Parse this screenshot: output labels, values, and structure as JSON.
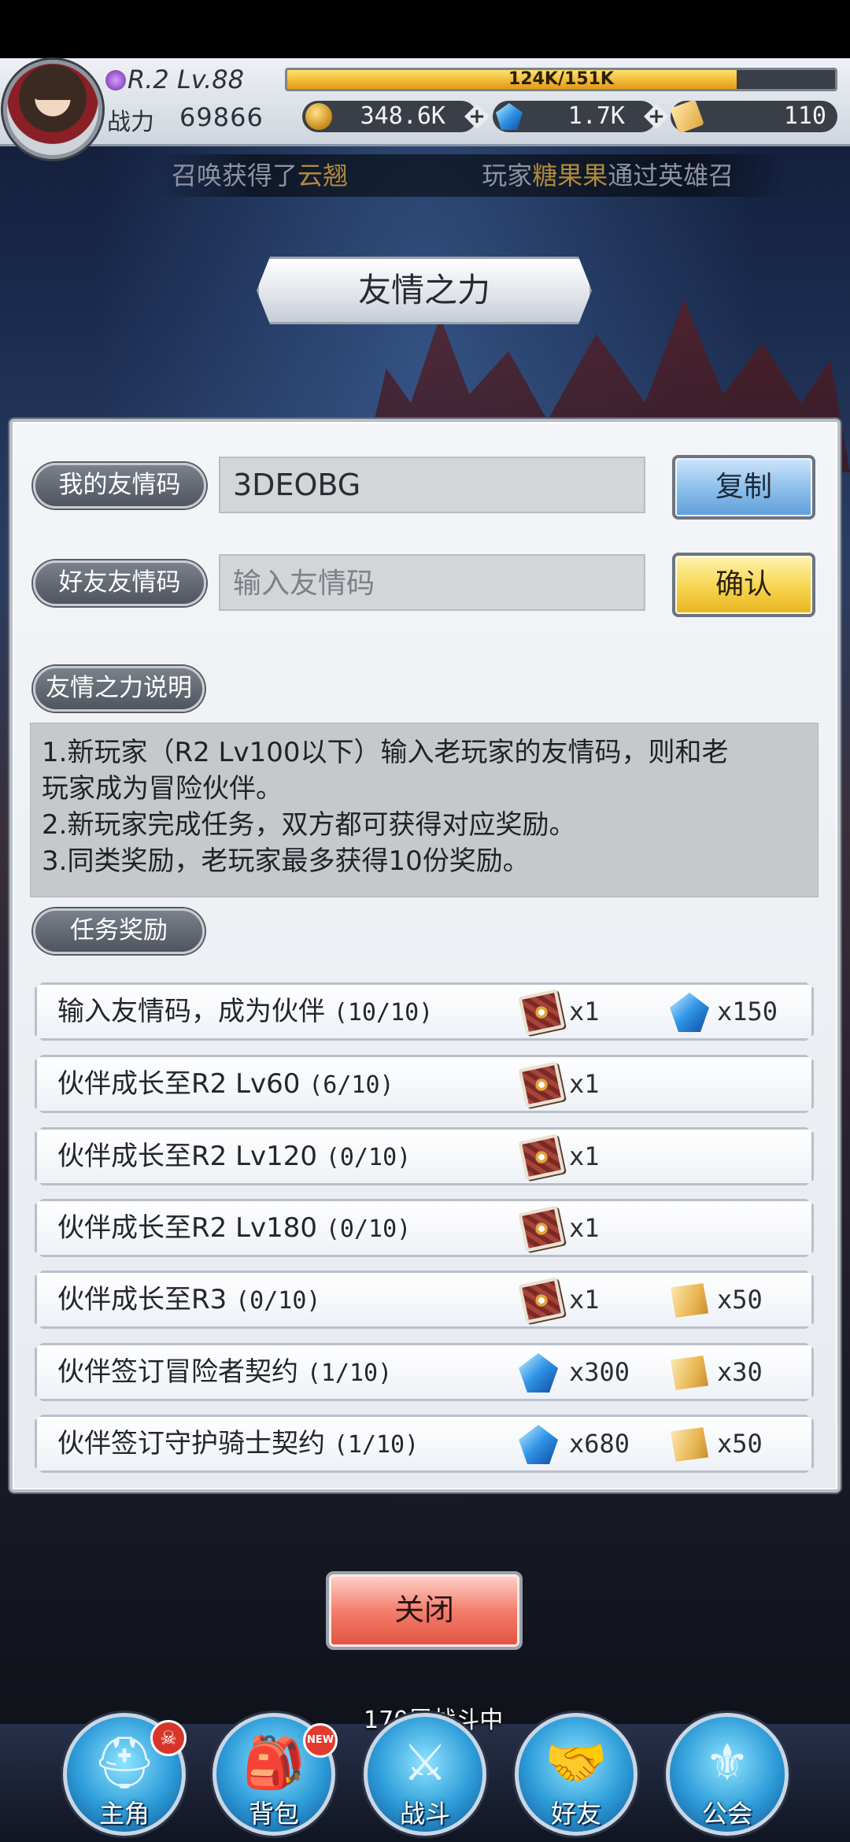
{
  "header": {
    "rank_level": "R.2 Lv.88",
    "xp_text": "124K/151K",
    "xp_fraction": 0.82,
    "power_label": "战力",
    "power_value": "69866",
    "gold": "348.6K",
    "gems": "1.7K",
    "tickets": "110"
  },
  "marquee": {
    "left_part1": "召唤获得了",
    "left_highlight": "云翘",
    "right_part1": "玩家",
    "right_highlight": "糖果果",
    "right_part2": "通过英雄召"
  },
  "title": "友情之力",
  "my_code": {
    "label": "我的友情码",
    "value": "3DEOBG",
    "button": "复制"
  },
  "friend_code": {
    "label": "好友友情码",
    "placeholder": "输入友情码",
    "button": "确认"
  },
  "description": {
    "label": "友情之力说明",
    "lines": [
      "1.新玩家（R2 Lv100以下）输入老玩家的友情码，则和老",
      "玩家成为冒险伙伴。",
      "2.新玩家完成任务，双方都可获得对应奖励。",
      "3.同类奖励，老玩家最多获得10份奖励。"
    ]
  },
  "tasks": {
    "label": "任务奖励",
    "items": [
      {
        "text": "输入友情码，成为伙伴",
        "progress": "(10/10)",
        "r1_icon": "card-icon",
        "r1_qty": "x1",
        "r2_icon": "diamond-icon",
        "r2_qty": "x150"
      },
      {
        "text": "伙伴成长至R2 Lv60",
        "progress": "(6/10)",
        "r1_icon": "card-icon",
        "r1_qty": "x1"
      },
      {
        "text": "伙伴成长至R2 Lv120",
        "progress": "(0/10)",
        "r1_icon": "card-icon",
        "r1_qty": "x1"
      },
      {
        "text": "伙伴成长至R2 Lv180",
        "progress": "(0/10)",
        "r1_icon": "card-icon",
        "r1_qty": "x1"
      },
      {
        "text": "伙伴成长至R3",
        "progress": "(0/10)",
        "r1_icon": "card-icon",
        "r1_qty": "x1",
        "r2_icon": "scroll-icon",
        "r2_qty": "x50"
      },
      {
        "text": "伙伴签订冒险者契约",
        "progress": "(1/10)",
        "r1_icon": "diamond-icon",
        "r1_qty": "x300",
        "r2_icon": "scroll-icon",
        "r2_qty": "x30"
      },
      {
        "text": "伙伴签订守护骑士契约",
        "progress": "(1/10)",
        "r1_icon": "diamond-icon",
        "r1_qty": "x680",
        "r2_icon": "scroll-icon",
        "r2_qty": "x50"
      }
    ]
  },
  "close_button": "关闭",
  "floor_status": "170层战斗中",
  "nav": {
    "hero": "主角",
    "bag": "背包",
    "bag_badge": "NEW",
    "battle": "战斗",
    "friends": "好友",
    "guild": "公会"
  }
}
